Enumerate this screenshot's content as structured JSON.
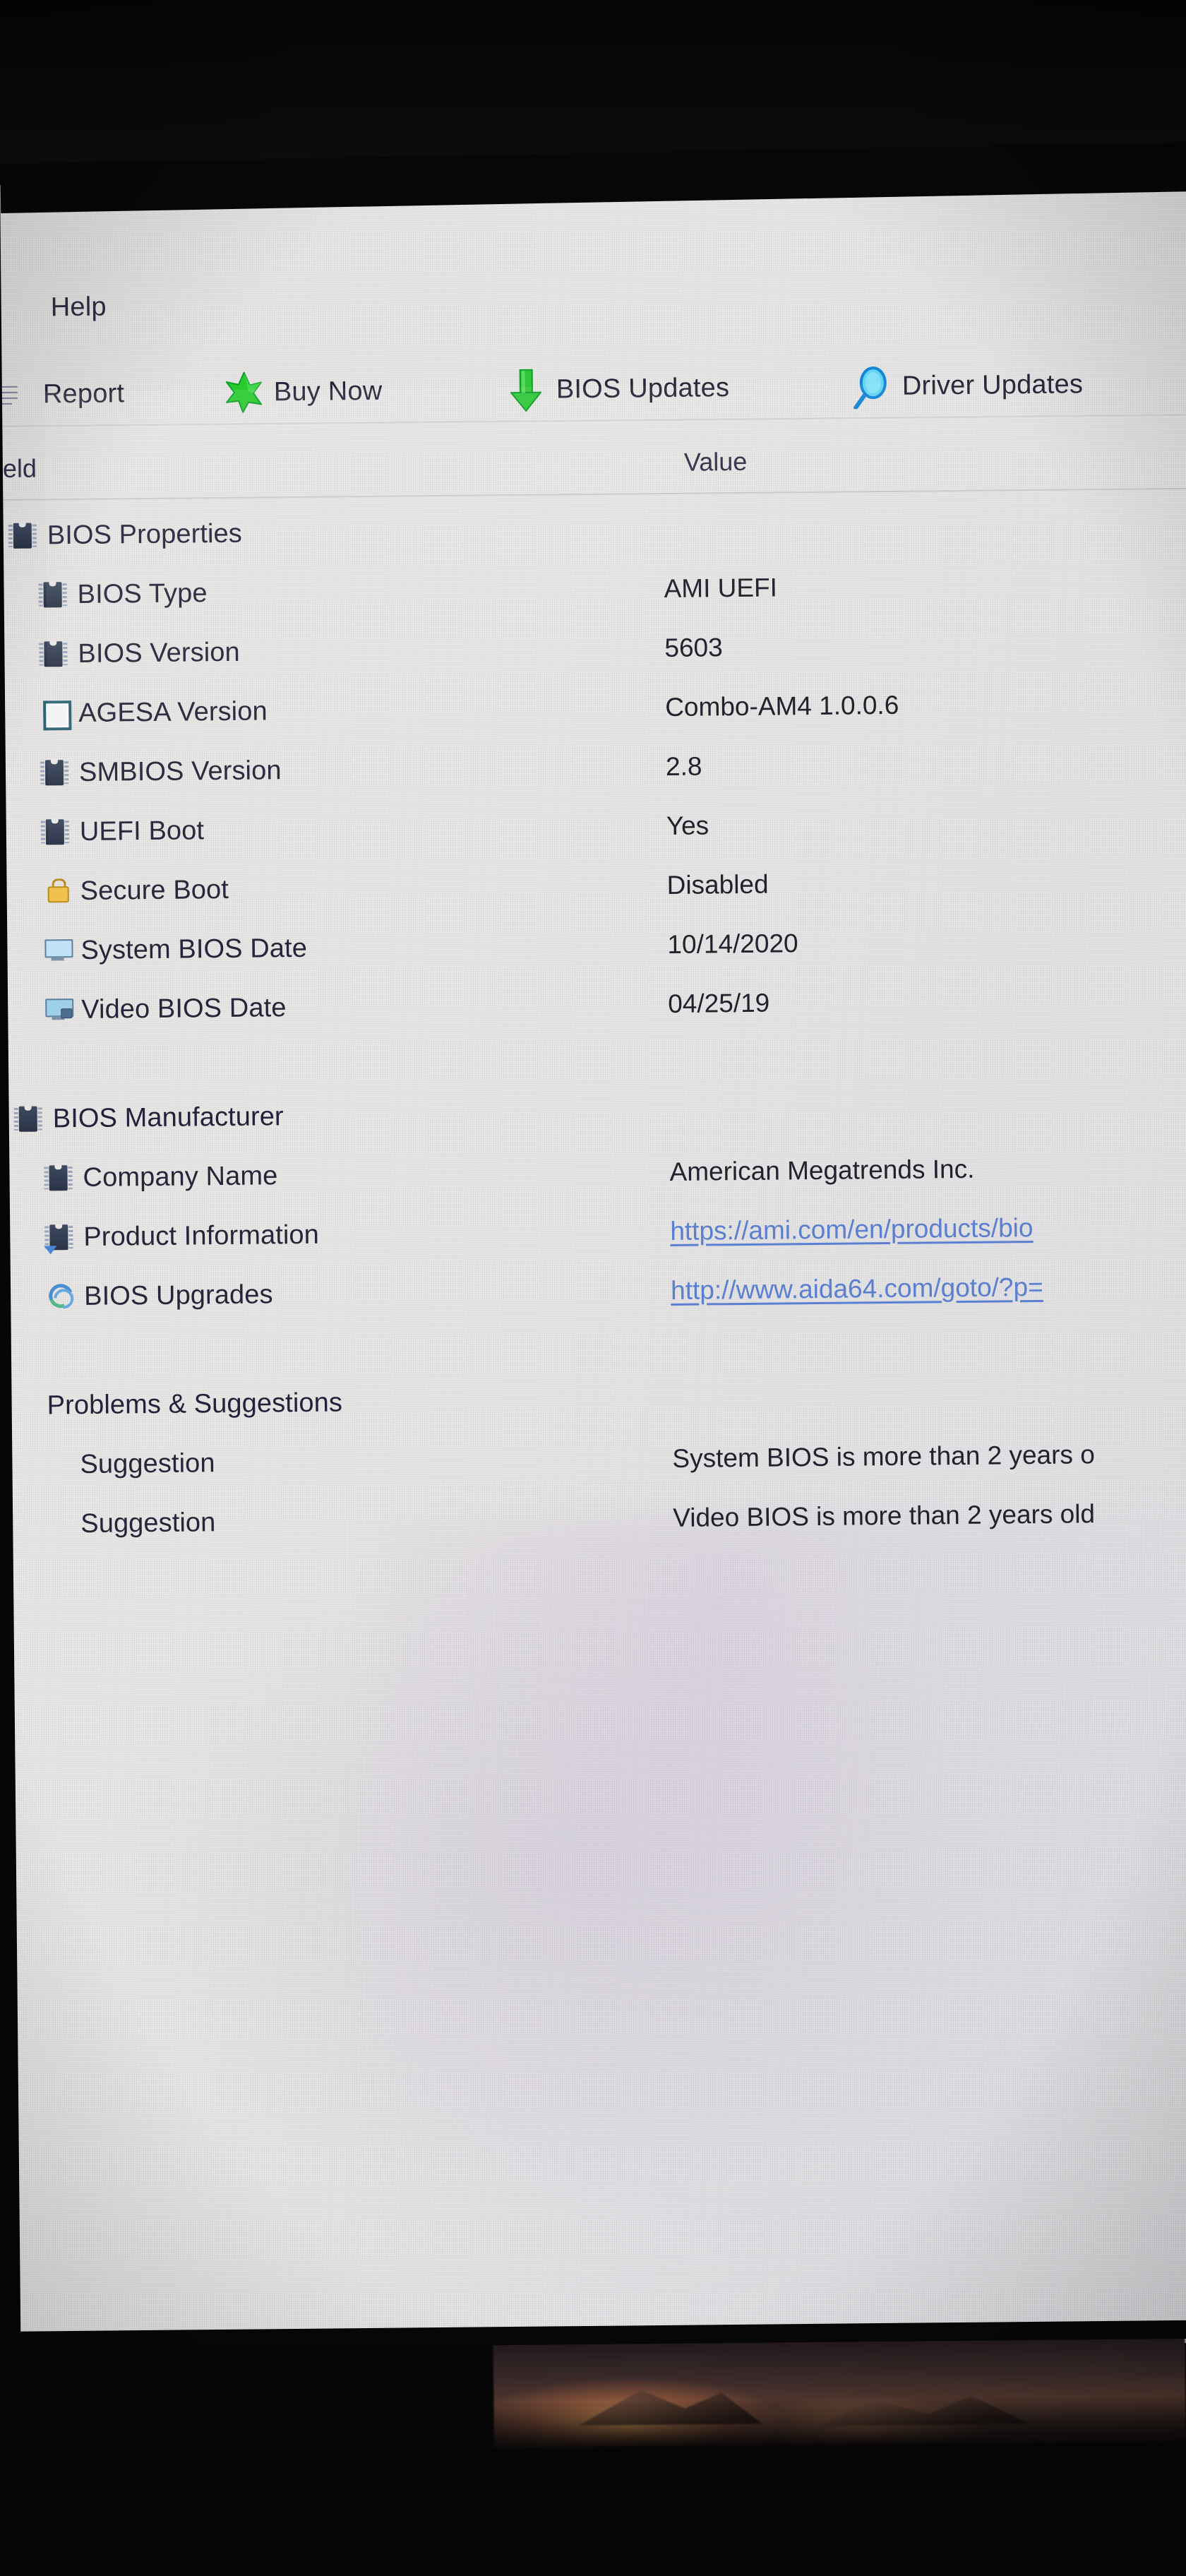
{
  "app": {
    "menu": [
      {
        "label": "Help"
      }
    ],
    "toolbar": [
      {
        "label": "Report",
        "icon": "report-page-icon"
      },
      {
        "label": "Buy Now",
        "icon": "green-star-icon"
      },
      {
        "label": "BIOS Updates",
        "icon": "green-down-arrow-icon"
      },
      {
        "label": "Driver Updates",
        "icon": "magnifier-icon"
      }
    ]
  },
  "table": {
    "headers": {
      "field": "eld",
      "value": "Value"
    },
    "rows": [
      {
        "label": "BIOS Properties",
        "value": "",
        "icon": "chip-icon",
        "indent": 0,
        "type": "group"
      },
      {
        "label": "BIOS Type",
        "value": "AMI UEFI",
        "icon": "chip-icon",
        "indent": 1,
        "type": "item"
      },
      {
        "label": "BIOS Version",
        "value": "5603",
        "icon": "chip-icon",
        "indent": 1,
        "type": "item"
      },
      {
        "label": "AGESA Version",
        "value": "Combo-AM4 1.0.0.6",
        "icon": "open-square-icon",
        "indent": 1,
        "type": "item"
      },
      {
        "label": "SMBIOS Version",
        "value": "2.8",
        "icon": "chip-icon",
        "indent": 1,
        "type": "item"
      },
      {
        "label": "UEFI Boot",
        "value": "Yes",
        "icon": "chip-icon",
        "indent": 1,
        "type": "item"
      },
      {
        "label": "Secure Boot",
        "value": "Disabled",
        "icon": "padlock-icon",
        "indent": 1,
        "type": "item"
      },
      {
        "label": "System BIOS Date",
        "value": "10/14/2020",
        "icon": "monitor-icon",
        "indent": 1,
        "type": "item"
      },
      {
        "label": "Video BIOS Date",
        "value": "04/25/19",
        "icon": "video-monitor-icon",
        "indent": 1,
        "type": "item"
      },
      {
        "label": "",
        "value": "",
        "icon": "",
        "indent": 0,
        "type": "spacer"
      },
      {
        "label": "BIOS Manufacturer",
        "value": "",
        "icon": "chip-icon",
        "indent": 0,
        "type": "group"
      },
      {
        "label": "Company Name",
        "value": "American Megatrends Inc.",
        "icon": "chip-icon",
        "indent": 1,
        "type": "item"
      },
      {
        "label": "Product Information",
        "value": "https://ami.com/en/products/bio",
        "icon": "product-info-icon",
        "indent": 1,
        "type": "link"
      },
      {
        "label": "BIOS Upgrades",
        "value": "http://www.aida64.com/goto/?p=",
        "icon": "bios-upgrades-icon",
        "indent": 1,
        "type": "link"
      },
      {
        "label": "",
        "value": "",
        "icon": "",
        "indent": 0,
        "type": "spacer"
      },
      {
        "label": "Problems & Suggestions",
        "value": "",
        "icon": "",
        "indent": 1,
        "type": "group-plain"
      },
      {
        "label": "Suggestion",
        "value": "System BIOS is more than 2 years o",
        "icon": "",
        "indent": 2,
        "type": "item"
      },
      {
        "label": "Suggestion",
        "value": "Video BIOS is more than 2 years old",
        "icon": "",
        "indent": 2,
        "type": "item"
      }
    ]
  },
  "colors": {
    "link": "#5a7fd0",
    "text": "#26263a",
    "screen_bg": "#e9e8e6",
    "star_green": "#25c52a",
    "arrow_green": "#2fc437",
    "magnifier_blue": "#22a3e8"
  }
}
